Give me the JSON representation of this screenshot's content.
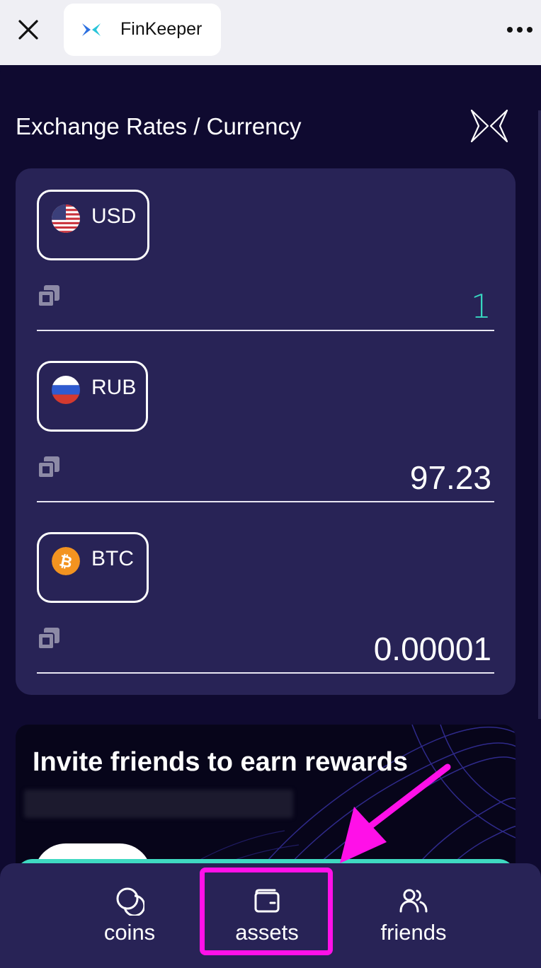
{
  "browser": {
    "tab_title": "FinKeeper"
  },
  "page": {
    "title": "Exchange Rates / Currency"
  },
  "currencies": [
    {
      "code": "USD",
      "value": "1",
      "flag": "us-flag-icon"
    },
    {
      "code": "RUB",
      "value": "97.23",
      "flag": "ru-flag-icon"
    },
    {
      "code": "BTC",
      "value": "0.00001",
      "flag": "btc-icon"
    }
  ],
  "banner": {
    "title": "Invite friends to earn rewards"
  },
  "bottom_nav": {
    "items": [
      {
        "label": "coins",
        "icon": "coins-icon"
      },
      {
        "label": "assets",
        "icon": "wallet-icon"
      },
      {
        "label": "friends",
        "icon": "users-icon"
      }
    ]
  },
  "colors": {
    "background": "#0f0a30",
    "card": "#282356",
    "accent": "#37d6c0",
    "highlight": "#ff10e8"
  }
}
